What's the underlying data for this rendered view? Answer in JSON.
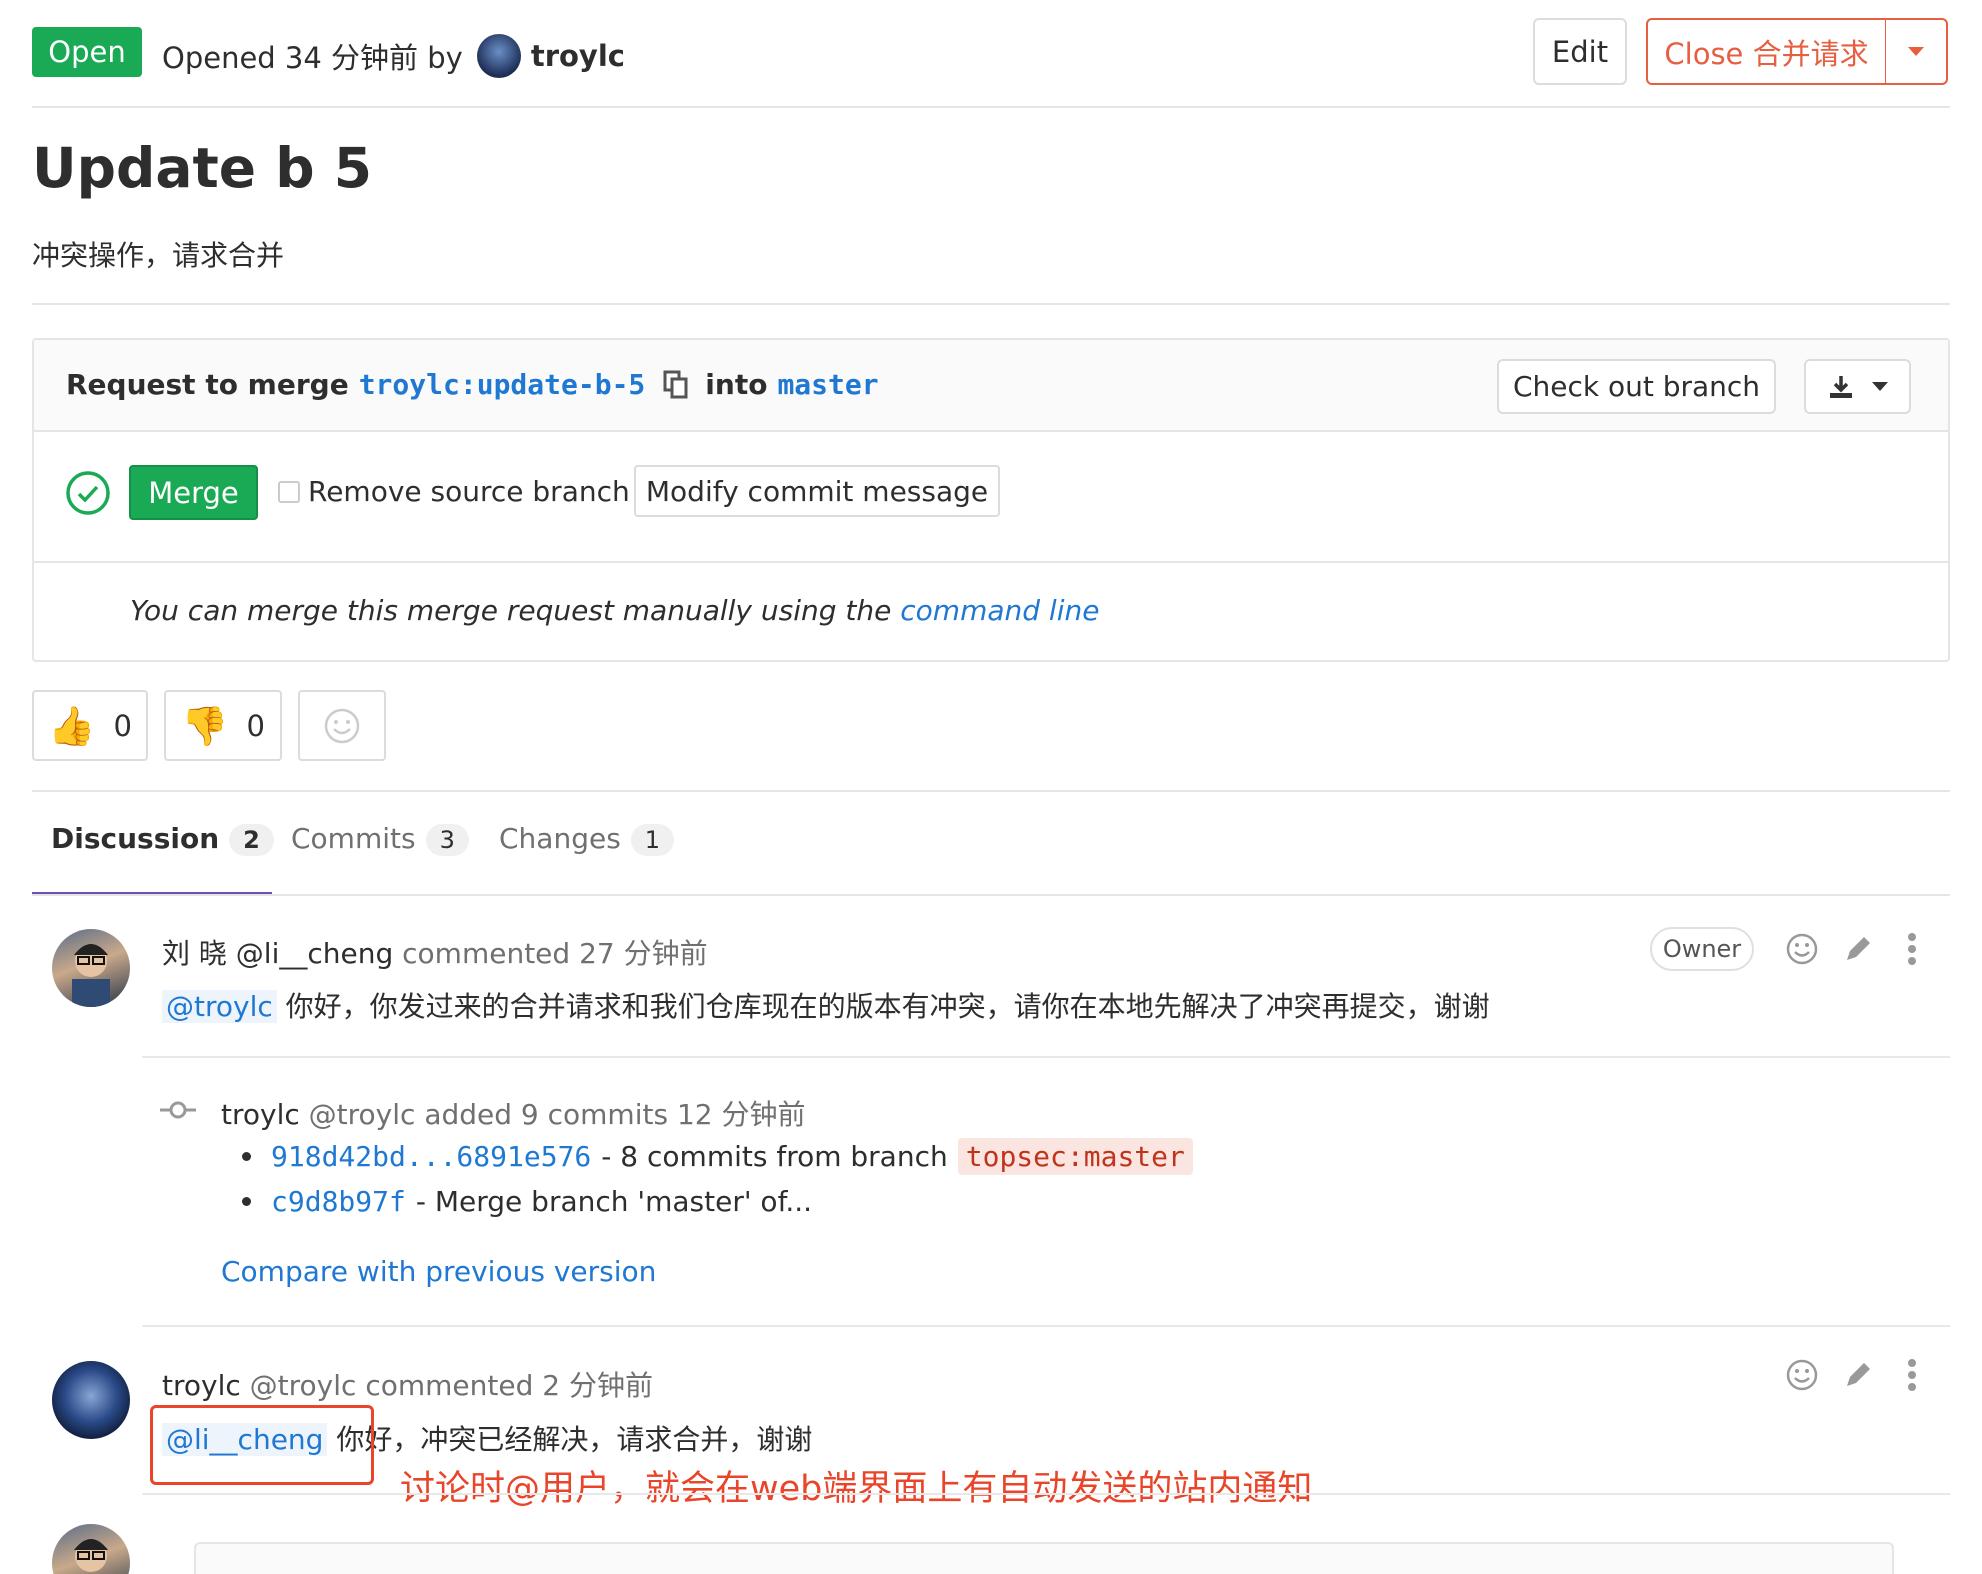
{
  "header": {
    "status": "Open",
    "opened_text": "Opened 34 分钟前 by",
    "author": "troylc",
    "edit_label": "Edit",
    "close_label": "Close 合并请求"
  },
  "title": "Update b 5",
  "description": "冲突操作，请求合并",
  "merge_widget": {
    "request_prefix": "Request to merge",
    "source_user": "troylc",
    "source_sep": ":",
    "source_branch": "update-b-5",
    "into_label": "into",
    "target_branch": "master",
    "checkout_label": "Check out branch",
    "merge_label": "Merge",
    "remove_source_label": "Remove source branch",
    "remove_source_checked": false,
    "modify_commit_label": "Modify commit message",
    "manual_text": "You can merge this merge request manually using the",
    "command_line_link": "command line"
  },
  "awards": {
    "thumbs_up_count": "0",
    "thumbs_down_count": "0"
  },
  "tabs": [
    {
      "label": "Discussion",
      "count": "2",
      "active": true
    },
    {
      "label": "Commits",
      "count": "3",
      "active": false
    },
    {
      "label": "Changes",
      "count": "1",
      "active": false
    }
  ],
  "notes": {
    "first": {
      "author_display": "刘 晓 @li__cheng",
      "action": "commented 27 分钟前",
      "role_badge": "Owner",
      "mention": "@troylc",
      "body": "你好，你发过来的合并请求和我们仓库现在的版本有冲突，请你在本地先解决了冲突再提交，谢谢"
    },
    "system": {
      "author": "troylc",
      "handle": "@troylc",
      "action": "added 9 commits 12 分钟前",
      "commits": [
        {
          "sha": "918d42bd...6891e576",
          "text": "- 8 commits from branch",
          "branch": "topsec:master"
        },
        {
          "sha": "c9d8b97f",
          "text": "- Merge branch 'master' of...",
          "branch": ""
        }
      ],
      "compare_link": "Compare with previous version"
    },
    "second": {
      "author": "troylc",
      "handle": "@troylc",
      "action": "commented 2 分钟前",
      "mention": "@li__cheng",
      "body": "你好，冲突已经解决，请求合并，谢谢"
    }
  },
  "annotation": {
    "text": "讨论时@用户，就会在web端界面上有自动发送的站内通知",
    "color": "#e8452a"
  },
  "colors": {
    "open_green": "#1aaa55",
    "close_orange": "#e75e40",
    "link_blue": "#1f78d1",
    "tab_underline": "#6b4fbb"
  }
}
